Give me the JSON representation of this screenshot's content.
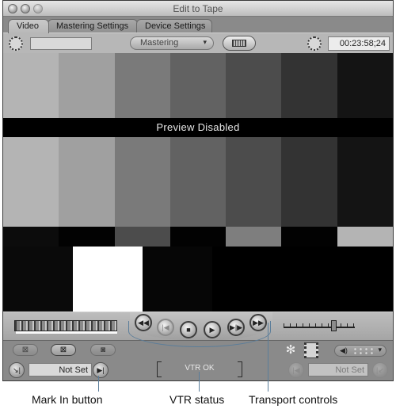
{
  "window": {
    "title": "Edit to Tape",
    "traffic_lights": [
      "close-button",
      "minimize-button",
      "zoom-button"
    ]
  },
  "tabs": [
    {
      "label": "Video",
      "active": true
    },
    {
      "label": "Mastering Settings",
      "active": false
    },
    {
      "label": "Device Settings",
      "active": false
    }
  ],
  "toolbar": {
    "in_timecode_value": "",
    "mode_select": {
      "selected": "Mastering",
      "arrow": "▾"
    },
    "filmstrip_button_icon": "filmstrip-icon",
    "duration_timecode": "00:23:58;24"
  },
  "video": {
    "overlay_text": "Preview Disabled",
    "colors": {
      "top_bars": [
        "#b4b4b4",
        "#a0a0a0",
        "#7a7a7a",
        "#626262",
        "#4c4c4c",
        "#333333",
        "#141414"
      ],
      "castellation": [
        "#0c0c0c",
        "#020202",
        "#4c4c4c",
        "#020202",
        "#7e7e7e",
        "#020202",
        "#b4b4b4"
      ],
      "pluge": [
        "#0a0a0a",
        "#ffffff",
        "#060606",
        "#000000",
        "#000000",
        "#000000"
      ]
    }
  },
  "transport": {
    "shuttle_icon": "shuttle-control",
    "buttons": [
      {
        "name": "rewind",
        "glyph": "◀◀",
        "enabled": true
      },
      {
        "name": "previous-edit",
        "glyph": "|◀",
        "enabled": false
      },
      {
        "name": "stop",
        "glyph": "■",
        "enabled": true
      },
      {
        "name": "play",
        "glyph": "▶",
        "enabled": true
      },
      {
        "name": "play-around",
        "glyph": "▶|▶",
        "enabled": true
      },
      {
        "name": "fast-forward",
        "glyph": "▶▶",
        "enabled": true
      }
    ],
    "jog_position": 0.71
  },
  "bottom": {
    "mark_buttons": [
      {
        "name": "mark-clip",
        "glyph": "⊠",
        "active": false
      },
      {
        "name": "mark-in-out",
        "glyph": "⊠",
        "active": true
      },
      {
        "name": "mark-point",
        "glyph": "◙",
        "active": false
      }
    ],
    "in_point": {
      "go_to_glyph": "↘|",
      "value": "Not Set",
      "mark_glyph": "▶|"
    },
    "vtr_status": "VTR OK",
    "out_point": {
      "mark_glyph": "|◀",
      "value": "Not Set",
      "go_to_glyph": "|↙"
    },
    "audio_select_glyph": "◀)",
    "audio_arrow": "▾",
    "snowflake_glyph": "✻"
  },
  "callouts": [
    {
      "label": "Mark In button"
    },
    {
      "label": "VTR status"
    },
    {
      "label": "Transport controls"
    }
  ],
  "accent_colors": {
    "callout_line": "#5a7d9a",
    "chrome": "#8d8d8d"
  }
}
